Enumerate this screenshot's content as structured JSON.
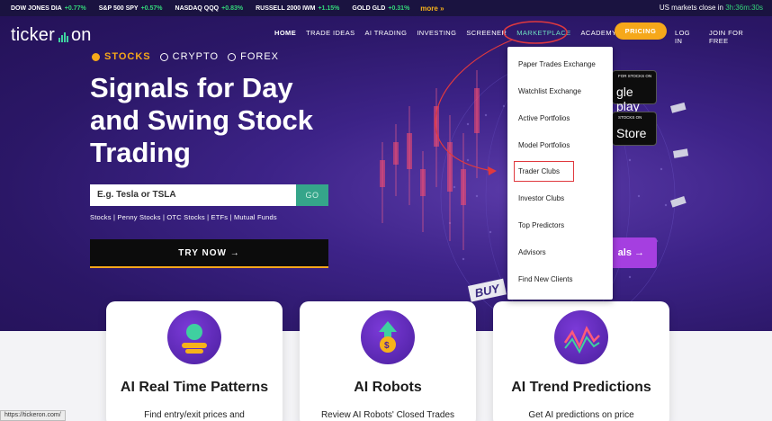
{
  "ticker": {
    "items": [
      {
        "name": "DOW JONES DIA",
        "change": "+0.77%"
      },
      {
        "name": "S&P 500 SPY",
        "change": "+0.57%"
      },
      {
        "name": "NASDAQ QQQ",
        "change": "+0.83%"
      },
      {
        "name": "RUSSELL 2000 IWM",
        "change": "+1.15%"
      },
      {
        "name": "GOLD GLD",
        "change": "+0.31%"
      }
    ],
    "more": "more »",
    "close_label": "US markets close in",
    "close_time": "3h:36m:30s"
  },
  "logo": {
    "left": "ticker",
    "right": "on"
  },
  "nav": {
    "home": "HOME",
    "trade_ideas": "TRADE IDEAS",
    "ai_trading": "AI TRADING",
    "investing": "INVESTING",
    "screener": "SCREENER",
    "marketplace": "MARKETPLACE",
    "academy": "ACADEMY",
    "pricing": "PRICING",
    "login": "LOG IN",
    "join": "JOIN FOR FREE"
  },
  "assets": [
    "STOCKS",
    "CRYPTO",
    "FOREX"
  ],
  "headline": [
    "Signals for Day",
    "and Swing Stock",
    "Trading"
  ],
  "search": {
    "placeholder": "E.g. Tesla or TSLA",
    "go": "GO"
  },
  "categories": "Stocks | Penny Stocks | OTC Stocks | ETFs | Mutual Funds",
  "try_now": "TRY NOW  →",
  "badges": {
    "google": {
      "small": "FOR STOCKS ON",
      "big": "gle play"
    },
    "apple": {
      "small": "STOCKS ON",
      "big": "Store"
    }
  },
  "signals_button": "als  →",
  "dropdown": [
    "Paper Trades Exchange",
    "Watchlist Exchange",
    "Active Portfolios",
    "Model Portfolios",
    "Trader Clubs",
    "Investor Clubs",
    "Top Predictors",
    "Advisors",
    "Find New Clients"
  ],
  "cards": [
    {
      "title": "AI Real Time Patterns",
      "desc": "Find entry/exit prices and"
    },
    {
      "title": "AI Robots",
      "desc": "Review AI Robots' Closed Trades"
    },
    {
      "title": "AI Trend Predictions",
      "desc": "Get AI predictions on price"
    }
  ],
  "status_url": "https://tickeron.com/",
  "colors": {
    "accent": "#f6a81a",
    "positive": "#34d67a",
    "hero": "#3d2388",
    "highlight": "#e0393e"
  }
}
